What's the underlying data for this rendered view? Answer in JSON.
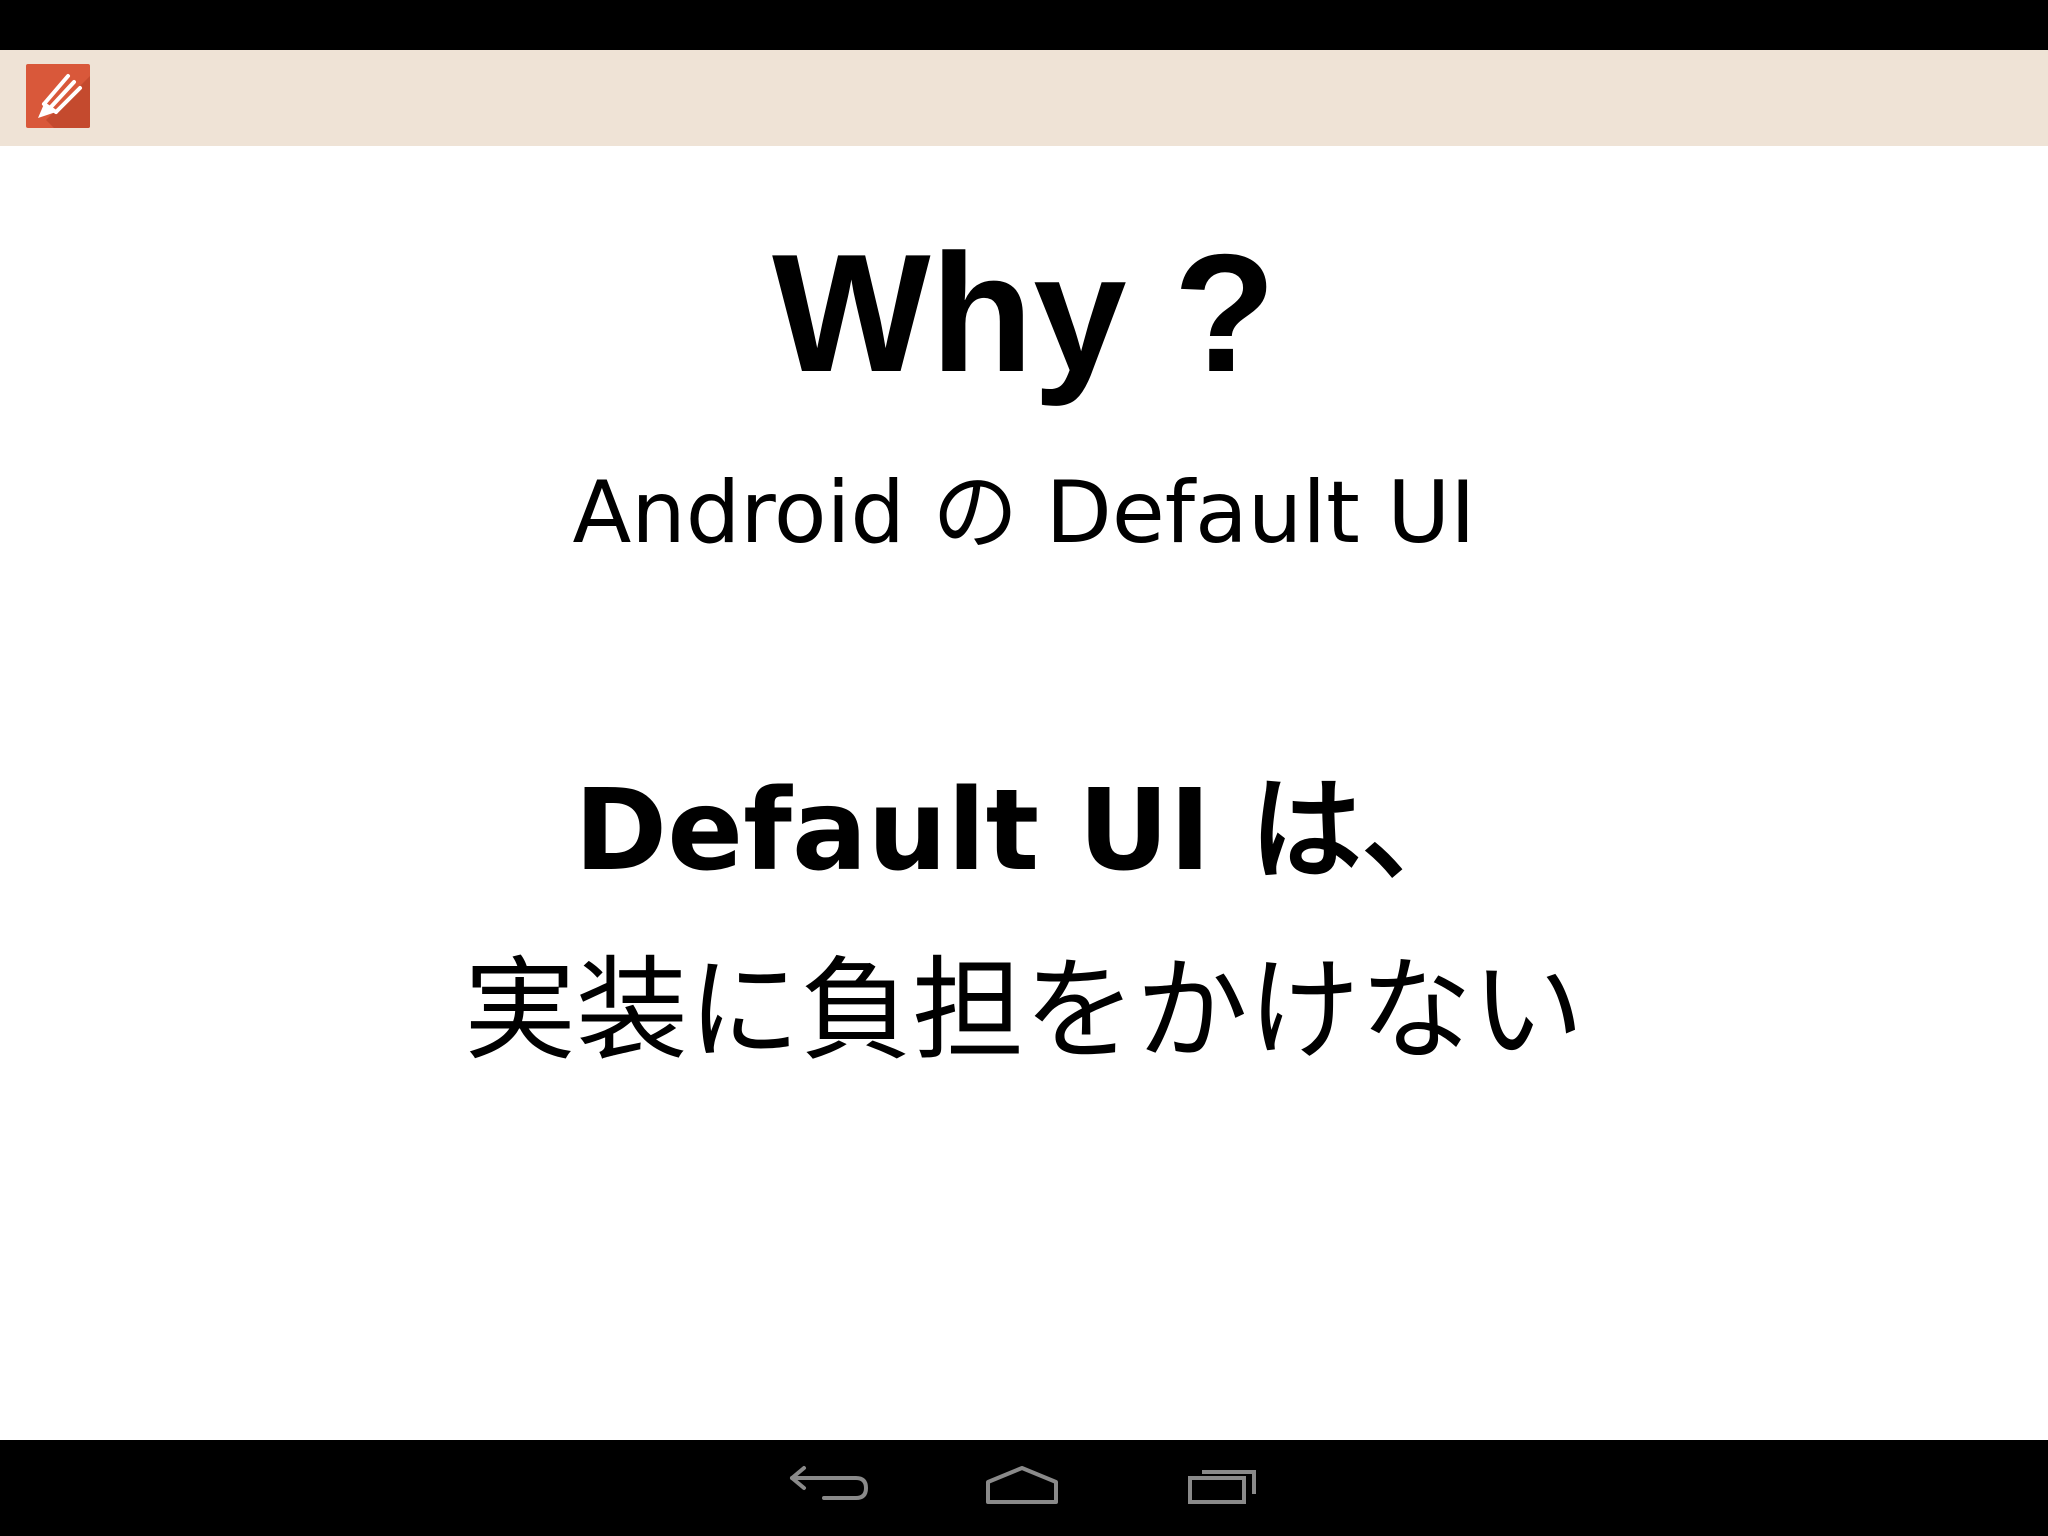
{
  "slide": {
    "title": "Why ?",
    "subtitle": "Android の Default UI",
    "line1": "Default UI は、",
    "line2": "実装に負担をかけない"
  },
  "action_bar": {
    "icon": "pencil-icon",
    "icon_color": "#d9583a",
    "background": "#efe3d6"
  },
  "nav_bar": {
    "buttons": [
      "back-icon",
      "home-icon",
      "recent-apps-icon"
    ]
  }
}
